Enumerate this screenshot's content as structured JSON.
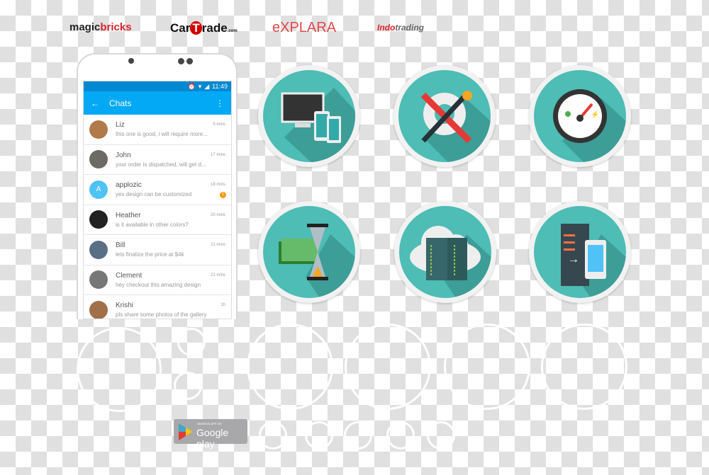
{
  "logos": [
    "magicbricks",
    "CarTrade",
    "eXPLARA",
    "Indotrading"
  ],
  "phone": {
    "status_time": "11:49",
    "appbar": {
      "title": "Chats",
      "back_icon": "arrow-left-icon",
      "menu_icon": "more-vert-icon"
    },
    "chats": [
      {
        "name": "Liz",
        "message": "this one is good, i will require more...",
        "time": "5 mins",
        "avatar_color": "#b07a4a"
      },
      {
        "name": "John",
        "message": "your order is dispatched, will get d...",
        "time": "17 mins",
        "avatar_color": "#6d6a66"
      },
      {
        "name": "applozic",
        "message": "yes design can be customized",
        "time": "18 mins",
        "avatar_letter": "A",
        "avatar_color": "#4fc3f7",
        "unread": "1"
      },
      {
        "name": "Heather",
        "message": "is it available in other colors?",
        "time": "20 mins",
        "avatar_color": "#222"
      },
      {
        "name": "Bill",
        "message": "lets finalize the price at $4k",
        "time": "21 mins",
        "avatar_color": "#5a6e85"
      },
      {
        "name": "Clement",
        "message": "hey checkout this amazing design",
        "time": "21 mins",
        "avatar_color": "#777"
      },
      {
        "name": "Krishi",
        "message": "pls share some photos of the gallery",
        "time": "1h",
        "avatar_color": "#a0704a"
      }
    ]
  },
  "feature_icons": [
    "devices-icon",
    "tools-icon",
    "speedometer-icon",
    "money-hourglass-icon",
    "cloud-server-icon",
    "server-to-phone-icon"
  ],
  "google_play": {
    "small": "ANDROID APP ON",
    "big": "Google play"
  },
  "accent": "#4dbdb5"
}
